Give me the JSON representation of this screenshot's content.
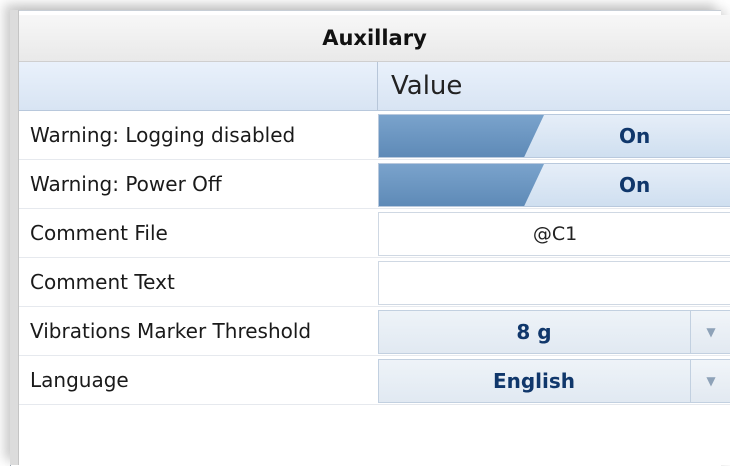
{
  "panel": {
    "title": "Auxillary",
    "column_header": "Value"
  },
  "rows": [
    {
      "label": "Warning: Logging disabled",
      "type": "toggle",
      "value": "On"
    },
    {
      "label": "Warning: Power Off",
      "type": "toggle",
      "value": "On"
    },
    {
      "label": "Comment File",
      "type": "text",
      "value": "@C1"
    },
    {
      "label": "Comment Text",
      "type": "text",
      "value": ""
    },
    {
      "label": "Vibrations Marker Threshold",
      "type": "dropdown",
      "value": "8 g"
    },
    {
      "label": "Language",
      "type": "dropdown",
      "value": "English"
    }
  ],
  "icons": {
    "dropdown": "chevron-down-icon"
  },
  "colors": {
    "header_bg": "#dfe9f6",
    "toggle_fill": "#6a94c0",
    "value_text": "#10376b"
  }
}
